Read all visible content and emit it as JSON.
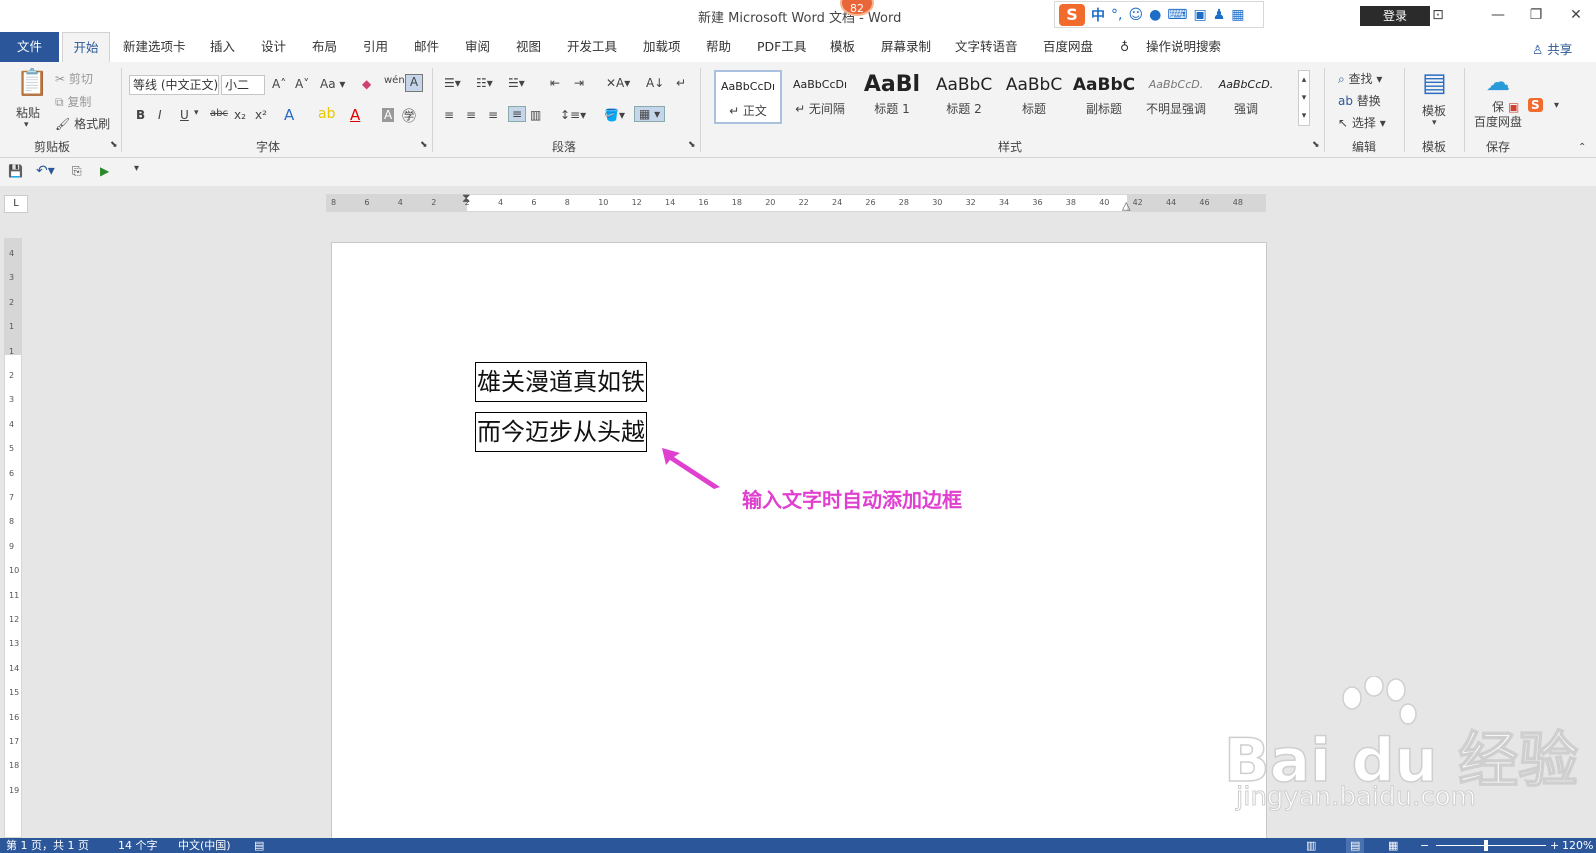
{
  "window": {
    "title": "新建 Microsoft Word 文档 - Word",
    "badge": "82",
    "login_label": "登录",
    "ime": {
      "logo": "S",
      "mode": "中",
      "punct": "°,",
      "icons": [
        "smile-icon",
        "microphone-icon",
        "keyboard-icon",
        "toolbox-icon",
        "shirt-icon",
        "grid-icon"
      ]
    }
  },
  "tabs": [
    "文件",
    "开始",
    "新建选项卡",
    "插入",
    "设计",
    "布局",
    "引用",
    "邮件",
    "审阅",
    "视图",
    "开发工具",
    "加载项",
    "帮助",
    "PDF工具",
    "模板",
    "屏幕录制",
    "文字转语音",
    "百度网盘"
  ],
  "tell_me": "操作说明搜索",
  "share_label": "共享",
  "ribbon": {
    "clipboard": {
      "paste": "粘贴",
      "cut": "剪切",
      "copy": "复制",
      "format_painter": "格式刷",
      "label": "剪贴板"
    },
    "font": {
      "font_name": "等线 (中文正文)",
      "font_size": "小二",
      "label": "字体",
      "case_label": "Aa"
    },
    "paragraph": {
      "label": "段落"
    },
    "styles": {
      "label": "样式",
      "items": [
        {
          "preview": "AaBbCcDı",
          "name": "↵ 正文"
        },
        {
          "preview": "AaBbCcDı",
          "name": "↵ 无间隔"
        },
        {
          "preview": "AaBl",
          "name": "标题 1"
        },
        {
          "preview": "AaBbC",
          "name": "标题 2"
        },
        {
          "preview": "AaBbC",
          "name": "标题"
        },
        {
          "preview": "AaBbC",
          "name": "副标题"
        },
        {
          "preview": "AaBbCcD.",
          "name": "不明显强调"
        },
        {
          "preview": "AaBbCcD.",
          "name": "强调"
        }
      ]
    },
    "editing": {
      "find": "查找",
      "replace": "替换",
      "select": "选择",
      "label": "编辑"
    },
    "template": {
      "button": "模板",
      "label": "模板"
    },
    "save": {
      "button": "保存到百度网盘",
      "button_line1": "保",
      "button_line2": "百度网盘",
      "label": "保存"
    }
  },
  "ruler": {
    "h_ticks": [
      "8",
      "6",
      "4",
      "2",
      "2",
      "4",
      "6",
      "8",
      "10",
      "12",
      "14",
      "16",
      "18",
      "20",
      "22",
      "24",
      "26",
      "28",
      "30",
      "32",
      "34",
      "36",
      "38",
      "40",
      "42",
      "44",
      "46",
      "48"
    ],
    "v_ticks": [
      "4",
      "3",
      "2",
      "1",
      "1",
      "2",
      "3",
      "4",
      "5",
      "6",
      "7",
      "8",
      "9",
      "10",
      "11",
      "12",
      "13",
      "14",
      "15",
      "16",
      "17",
      "18",
      "19"
    ]
  },
  "document": {
    "lines": [
      "雄关漫道真如铁",
      "而今迈步从头越"
    ]
  },
  "annotation": "输入文字时自动添加边框",
  "watermark": {
    "logo": "Bai du 经验",
    "url": "jingyan.baidu.com"
  },
  "status": {
    "page": "第 1 页，共 1 页",
    "words": "14 个字",
    "language": "中文(中国)",
    "zoom": "120%"
  },
  "colors": {
    "accent": "#2b579a",
    "annotation": "#e040d0",
    "ribbon_bg": "#f3f3f3"
  }
}
